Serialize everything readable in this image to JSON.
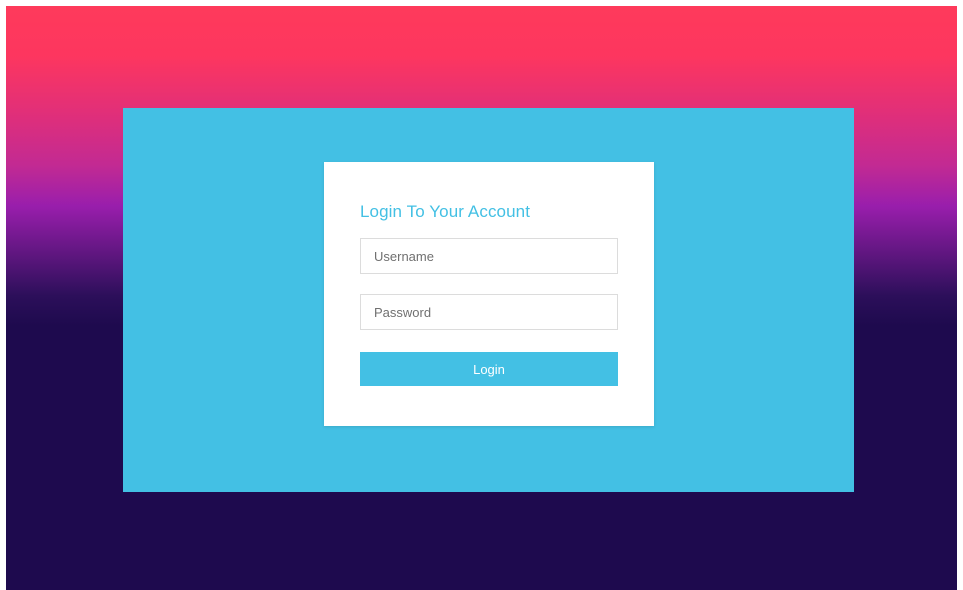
{
  "login_form": {
    "title": "Login To Your Account",
    "username": {
      "value": "",
      "placeholder": "Username"
    },
    "password": {
      "value": "",
      "placeholder": "Password"
    },
    "login_label": "Login"
  },
  "colors": {
    "accent": "#43c0e4",
    "card_background": "#ffffff",
    "gradient_top": "#fe3a5b",
    "gradient_mid": "#991eac",
    "gradient_bottom": "#1e0a4e"
  }
}
